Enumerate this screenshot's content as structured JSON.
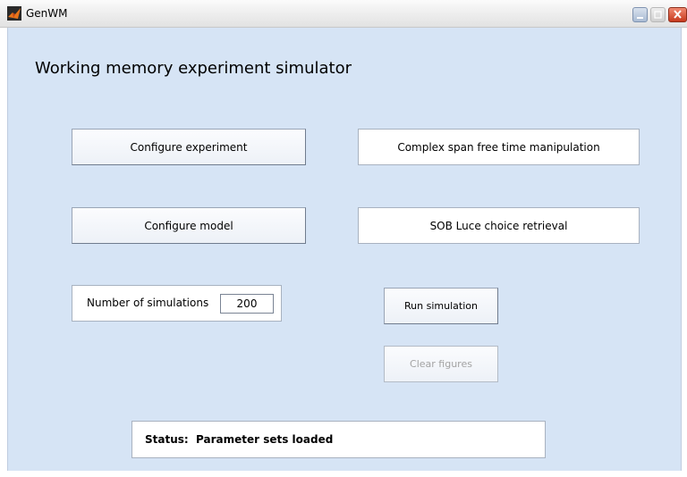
{
  "window": {
    "title": "GenWM"
  },
  "main": {
    "heading": "Working memory experiment simulator"
  },
  "buttons": {
    "configure_experiment": "Configure experiment",
    "configure_model": "Configure model",
    "run_simulation": "Run simulation",
    "clear_figures": "Clear figures"
  },
  "selections": {
    "experiment": "Complex span free time manipulation",
    "model": "SOB Luce choice retrieval"
  },
  "simulations": {
    "label": "Number of simulations",
    "value": "200"
  },
  "status": {
    "label": "Status:",
    "value": "Parameter sets loaded"
  },
  "colors": {
    "background": "#d6e4f5",
    "close_button": "#c7391d",
    "disabled_text": "#a3a3a3"
  },
  "icons": {
    "app": "matlab-icon",
    "minimize": "minimize-icon",
    "maximize": "maximize-icon",
    "close": "close-icon"
  }
}
